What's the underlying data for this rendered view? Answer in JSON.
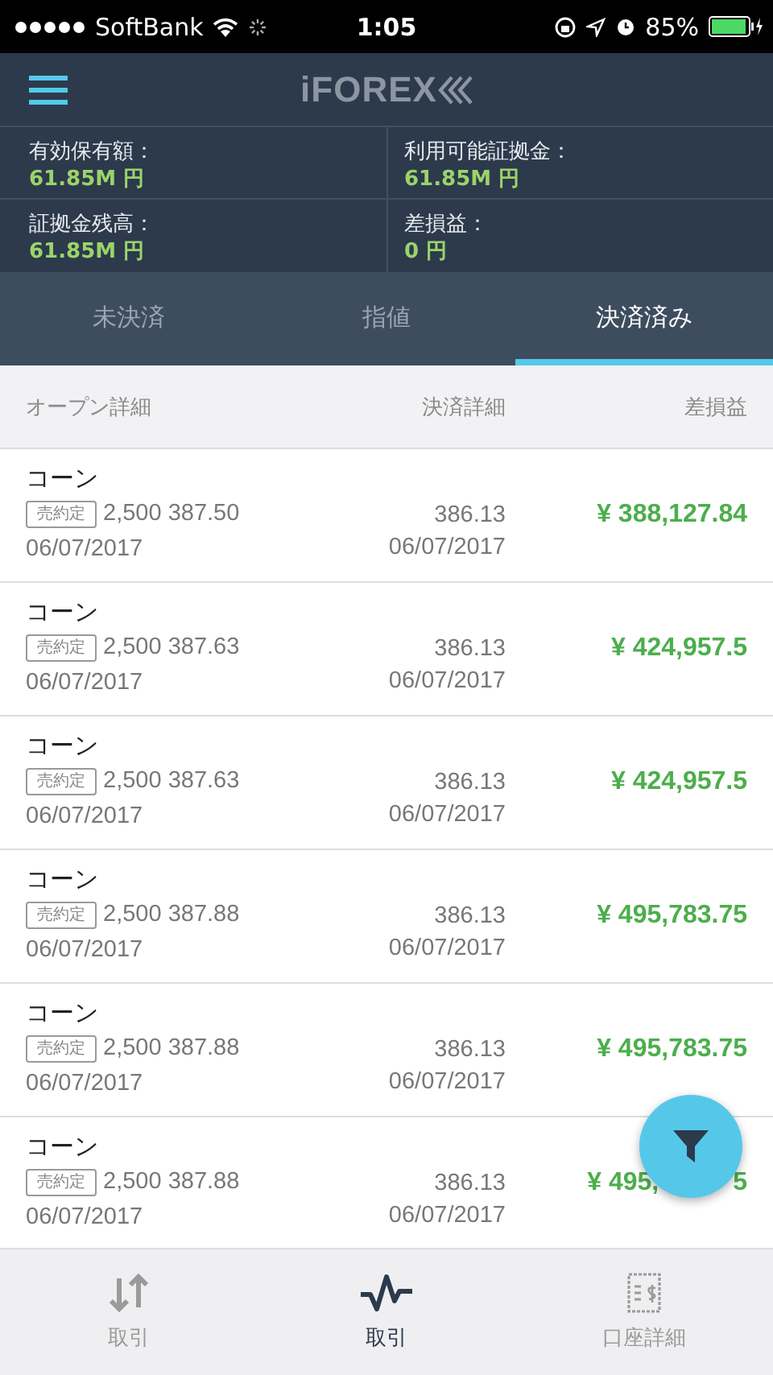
{
  "status_bar": {
    "carrier": "SoftBank",
    "time": "1:05",
    "battery": "85%"
  },
  "header": {
    "logo": "iFOREX"
  },
  "summary": [
    {
      "label": "有効保有額：",
      "value": "61.85M 円"
    },
    {
      "label": "利用可能証拠金：",
      "value": "61.85M 円"
    },
    {
      "label": "証拠金残高：",
      "value": "61.85M 円"
    },
    {
      "label": "差損益：",
      "value": "0 円"
    }
  ],
  "tabs": [
    {
      "label": "未決済",
      "selected": false
    },
    {
      "label": "指値",
      "selected": false
    },
    {
      "label": "決済済み",
      "selected": true
    }
  ],
  "table": {
    "columns": [
      "オープン詳細",
      "決済詳細",
      "差損益"
    ],
    "rows": [
      {
        "name": "コーン",
        "badge": "売約定",
        "open": "2,500 387.50",
        "open_date": "06/07/2017",
        "close": "386.13",
        "close_date": "06/07/2017",
        "profit": "¥ 388,127.84"
      },
      {
        "name": "コーン",
        "badge": "売約定",
        "open": "2,500 387.63",
        "open_date": "06/07/2017",
        "close": "386.13",
        "close_date": "06/07/2017",
        "profit": "¥ 424,957.5"
      },
      {
        "name": "コーン",
        "badge": "売約定",
        "open": "2,500 387.63",
        "open_date": "06/07/2017",
        "close": "386.13",
        "close_date": "06/07/2017",
        "profit": "¥ 424,957.5"
      },
      {
        "name": "コーン",
        "badge": "売約定",
        "open": "2,500 387.88",
        "open_date": "06/07/2017",
        "close": "386.13",
        "close_date": "06/07/2017",
        "profit": "¥ 495,783.75"
      },
      {
        "name": "コーン",
        "badge": "売約定",
        "open": "2,500 387.88",
        "open_date": "06/07/2017",
        "close": "386.13",
        "close_date": "06/07/2017",
        "profit": "¥ 495,783.75"
      },
      {
        "name": "コーン",
        "badge": "売約定",
        "open": "2,500 387.88",
        "open_date": "06/07/2017",
        "close": "386.13",
        "close_date": "06/07/2017",
        "profit": "¥ 495,",
        "profit_tail": "5"
      }
    ]
  },
  "bottom_nav": [
    {
      "kind": "trade",
      "label": "取引",
      "selected": false
    },
    {
      "kind": "pulse",
      "label": "取引",
      "selected": true
    },
    {
      "kind": "account",
      "label": "口座詳細",
      "selected": false
    }
  ]
}
